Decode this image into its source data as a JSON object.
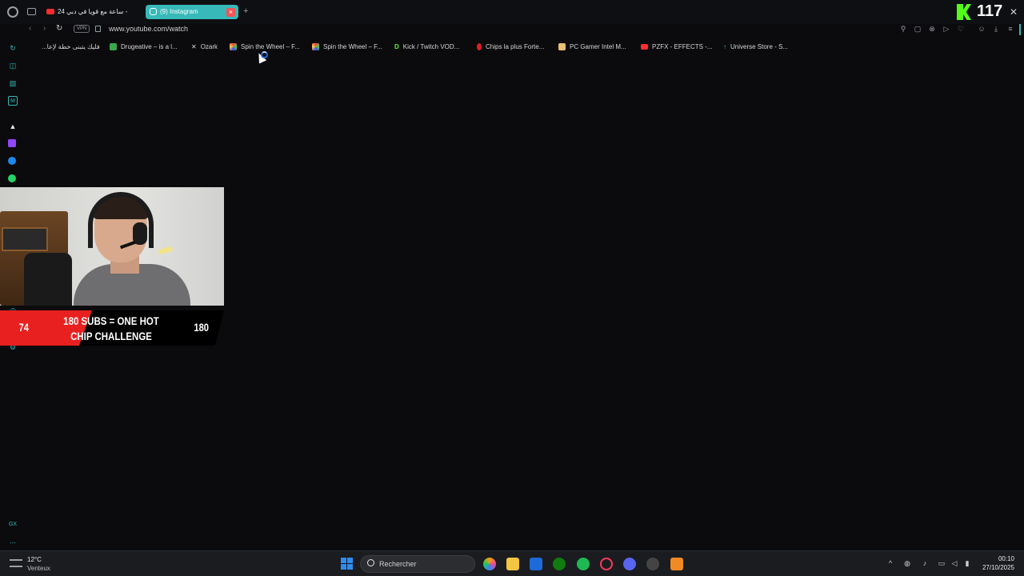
{
  "browser": {
    "tabs": [
      {
        "label": "24 ساعة مع قويا في دبي -",
        "favicon": "youtube-icon"
      },
      {
        "label": "(9) Instagram",
        "favicon": "instagram-icon",
        "active": true
      }
    ],
    "url": "www.youtube.com/watch",
    "vpn_label": "VPN",
    "bookmarks": [
      {
        "label": "...فليك يتبنى خطة لإعا",
        "icon": "page-icon"
      },
      {
        "label": "Drugeative – is a l...",
        "icon": "drugeative-icon"
      },
      {
        "label": "Ozark",
        "icon": "x-icon"
      },
      {
        "label": "Spin the Wheel – F...",
        "icon": "wheel-icon"
      },
      {
        "label": "Spin the Wheel – F...",
        "icon": "wheel-icon"
      },
      {
        "label": "Kick / Twitch VOD...",
        "icon": "kick-icon"
      },
      {
        "label": "Chips la plus Forte...",
        "icon": "chili-icon"
      },
      {
        "label": "PC Gamer Intel M...",
        "icon": "pc-icon"
      },
      {
        "label": "PZFX - EFFECTS -...",
        "icon": "youtube-icon"
      },
      {
        "label": "Universe Store - S...",
        "icon": "arrow-icon"
      }
    ]
  },
  "overlay": {
    "kick_counter": "117",
    "sub_goal": {
      "current": "74",
      "target": "180",
      "title": "180 SUBS = ONE HOT CHIP CHALLENGE",
      "progress": 0.41
    }
  },
  "sidebar": {
    "items": [
      "history-icon",
      "bag-icon",
      "aria-icon",
      "mail-icon",
      "kick-icon",
      "twitch-icon",
      "messenger-icon",
      "whatsapp-icon",
      "clock-icon",
      "settings-icon",
      "gx-icon",
      "more-icon"
    ],
    "gx_label": "GX",
    "more_label": "..."
  },
  "taskbar": {
    "weather_temp": "12°C",
    "weather_desc": "Venteux",
    "search_placeholder": "Rechercher",
    "time": "00:10",
    "date": "27/10/2025"
  },
  "colors": {
    "accent_teal": "#37b9b9",
    "kick_green": "#53fc18",
    "goal_red": "#e8201f"
  }
}
